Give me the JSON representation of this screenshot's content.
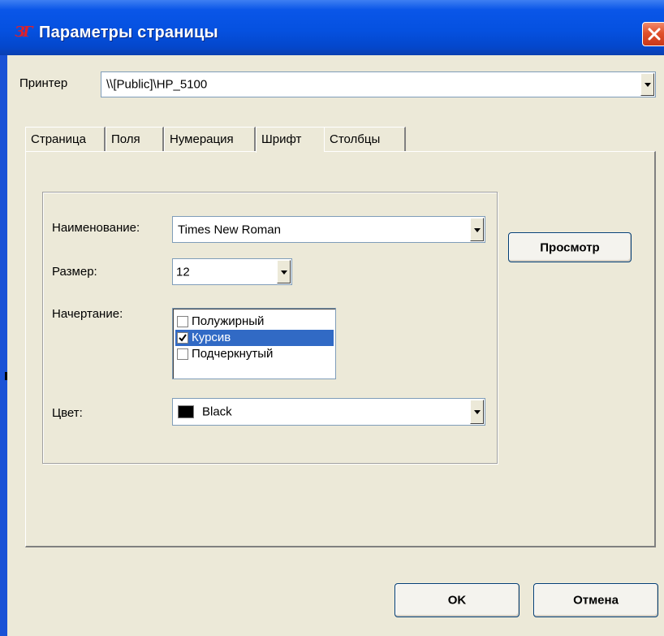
{
  "window": {
    "title": "Параметры страницы",
    "icon": "app-logo-icon"
  },
  "printer": {
    "label": "Принтер",
    "value": "\\\\[Public]\\HP_5100"
  },
  "tabs": [
    {
      "label": "Страница",
      "active": false
    },
    {
      "label": "Поля",
      "active": false
    },
    {
      "label": "Нумерация",
      "active": false
    },
    {
      "label": "Шрифт",
      "active": true
    },
    {
      "label": "Столбцы",
      "active": false
    }
  ],
  "font": {
    "name_label": "Наименование:",
    "name_value": "Times New Roman",
    "size_label": "Размер:",
    "size_value": "12",
    "style_label": "Начертание:",
    "styles": [
      {
        "label": "Полужирный",
        "checked": false,
        "selected": false
      },
      {
        "label": "Курсив",
        "checked": true,
        "selected": true
      },
      {
        "label": "Подчеркнутый",
        "checked": false,
        "selected": false
      }
    ],
    "color_label": "Цвет:",
    "color_value": "Black",
    "color_hex": "#000000"
  },
  "buttons": {
    "preview": "Просмотр",
    "ok": "OK",
    "cancel": "Отмена"
  },
  "colors": {
    "titlebar": "#0551e0",
    "close": "#e0502b",
    "selection": "#316ac5",
    "dialog": "#ECE9D8"
  }
}
